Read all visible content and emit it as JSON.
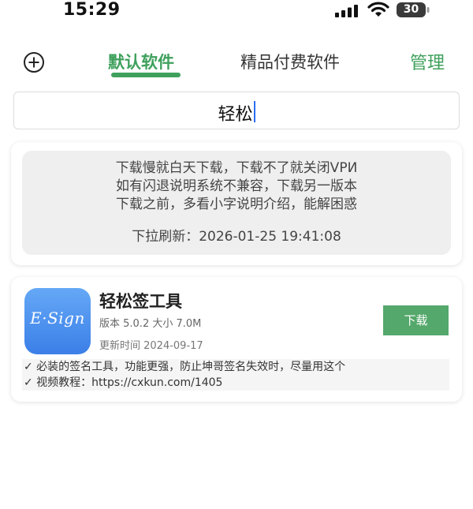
{
  "status_bar": {
    "time": "15:29",
    "battery": "30"
  },
  "nav": {
    "tabs": [
      {
        "label": "默认软件",
        "active": true
      },
      {
        "label": "精品付费软件",
        "active": false
      }
    ],
    "manage_label": "管理"
  },
  "search": {
    "value": "轻松"
  },
  "notice": {
    "lines": [
      "下载慢就白天下载，下载不了就关闭VPИ",
      "如有闪退说明系统不兼容，下载另一版本",
      "下载之前，多看小字说明介绍，能解困惑"
    ],
    "refresh_text": "下拉刷新：2026-01-25 19:41:08"
  },
  "apps": [
    {
      "icon_text": "E·Sign",
      "name": "轻松签工具",
      "meta": "版本 5.0.2 大小 7.0M",
      "updated": "更新时间 2024-09-17",
      "download_label": "下载",
      "description": [
        "✓ 必装的签名工具，功能更强，防止坤哥签名失效时，尽量用这个",
        "✓ 视频教程：https://cxkun.com/1405"
      ]
    }
  ],
  "colors": {
    "accent": "#3ea05c",
    "download_button": "#54a86b",
    "caret": "#2a6cf0"
  }
}
